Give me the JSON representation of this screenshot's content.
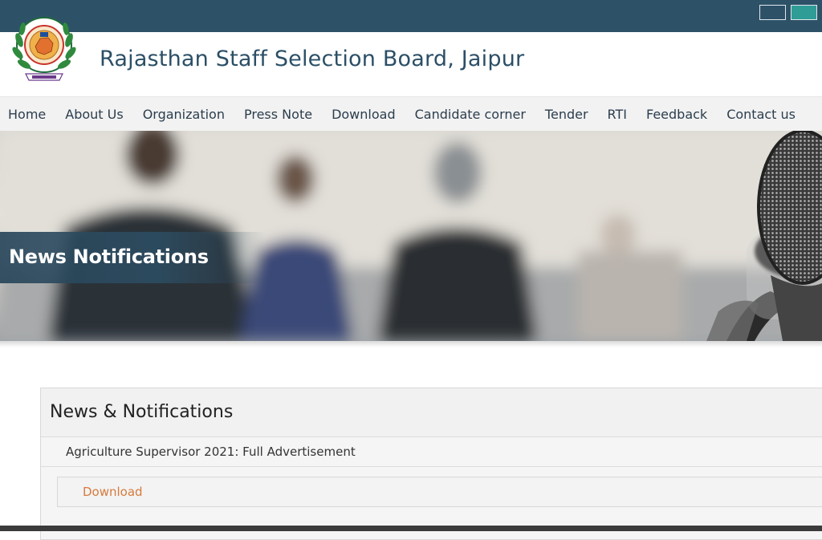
{
  "header": {
    "title": "Rajasthan Staff Selection Board, Jaipur",
    "logo_icon": "rssb-emblem-logo"
  },
  "theme_buttons": {
    "colors": [
      "#2d5268",
      "#2f9c96"
    ]
  },
  "nav": {
    "items": [
      {
        "label": "Home"
      },
      {
        "label": "About Us"
      },
      {
        "label": "Organization"
      },
      {
        "label": "Press Note"
      },
      {
        "label": "Download"
      },
      {
        "label": "Candidate corner"
      },
      {
        "label": "Tender"
      },
      {
        "label": "RTI"
      },
      {
        "label": "Feedback"
      },
      {
        "label": "Contact us"
      }
    ]
  },
  "banner": {
    "title": "News Notifications"
  },
  "notifications": {
    "heading": "News & Notifications",
    "items": [
      {
        "title": "Agriculture Supervisor 2021: Full Advertisement",
        "link_label": "Download"
      }
    ]
  },
  "colors": {
    "topbar": "#2d5268",
    "title": "#2b4f66",
    "link": "#d67a3d"
  }
}
